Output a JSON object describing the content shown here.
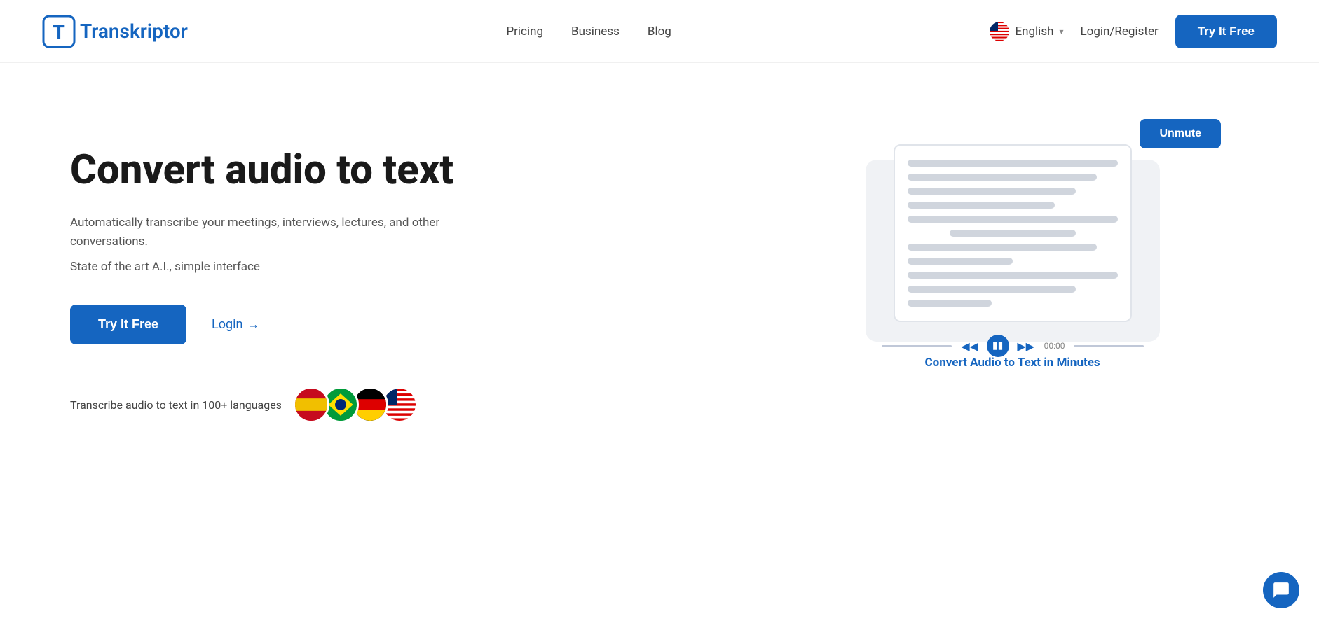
{
  "navbar": {
    "logo_text_prefix": "T",
    "logo_text_suffix": "ranskriptor",
    "nav_links": [
      {
        "label": "Pricing",
        "id": "pricing"
      },
      {
        "label": "Business",
        "id": "business"
      },
      {
        "label": "Blog",
        "id": "blog"
      }
    ],
    "language_label": "English",
    "login_label": "Login/Register",
    "try_free_label": "Try It Free"
  },
  "hero": {
    "title": "Convert audio to text",
    "subtitle1": "Automatically transcribe your meetings, interviews, lectures, and other conversations.",
    "subtitle2": "State of the art A.I., simple interface",
    "try_it_free_label": "Try It Free",
    "login_label": "Login",
    "login_arrow": "→",
    "languages_text": "Transcribe audio to text in 100+ languages",
    "flags": [
      "🇪🇸",
      "🇧🇷",
      "🇩🇪",
      "🇺🇸"
    ],
    "unmute_label": "Unmute",
    "convert_text": "Convert Audio to Text in Minutes",
    "player_time": "00:00"
  },
  "chat": {
    "label": "chat-bubble"
  }
}
